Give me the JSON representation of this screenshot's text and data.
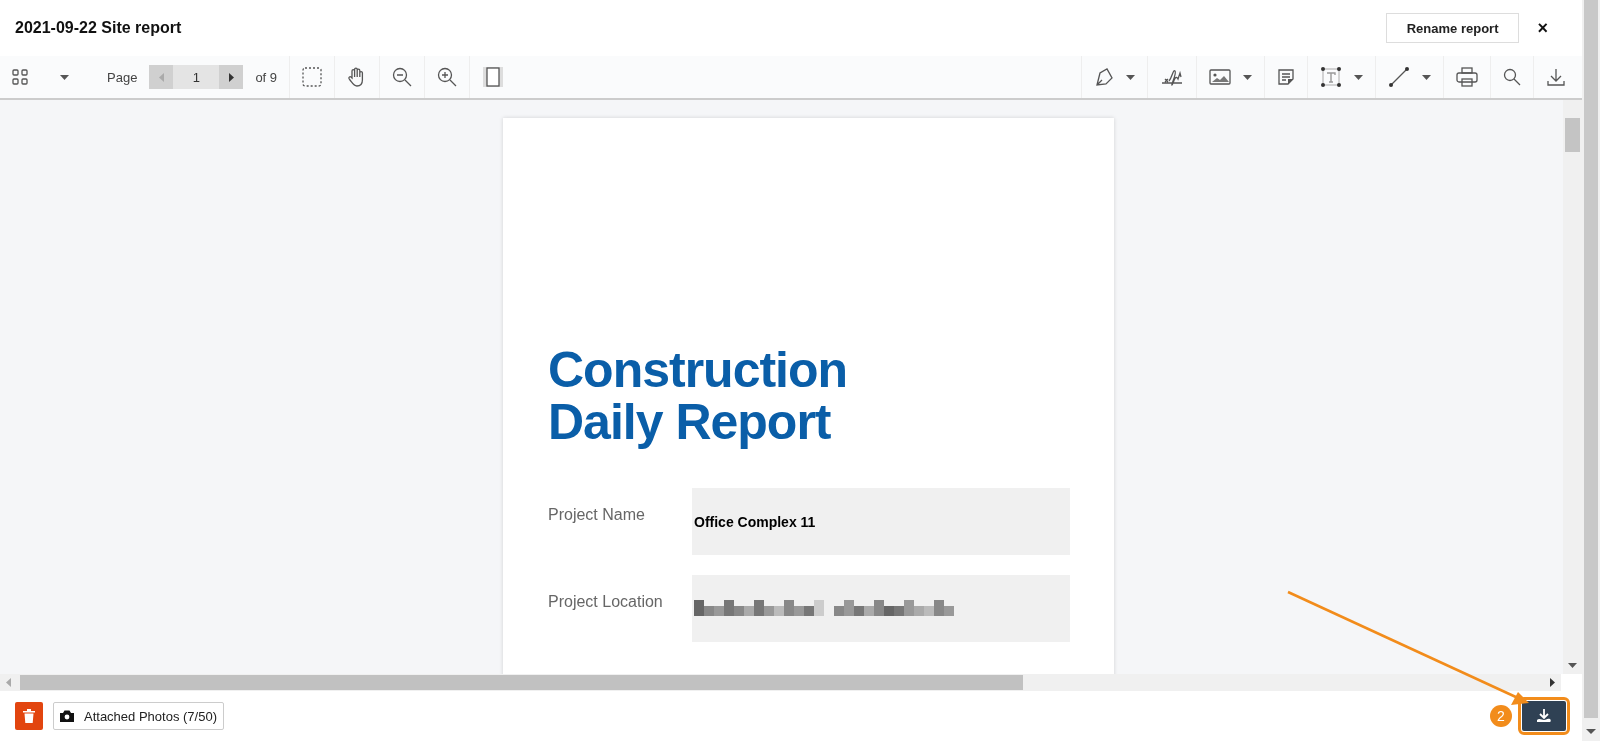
{
  "window": {
    "title": "2021-09-22 Site report"
  },
  "header": {
    "rename_button": "Rename report",
    "close_button": "×"
  },
  "toolbar": {
    "page_label": "Page",
    "page_number": "1",
    "page_count": "of 9"
  },
  "document": {
    "title_lines": [
      "Construction",
      "Daily Report"
    ],
    "fields": [
      {
        "label": "Project Name",
        "value": "Office Complex 11",
        "redacted": false
      },
      {
        "label": "Project Location",
        "redacted": true
      }
    ]
  },
  "footer": {
    "photos_button": "Attached Photos (7/50)",
    "step_badge": "2",
    "download_highlighted": true
  }
}
